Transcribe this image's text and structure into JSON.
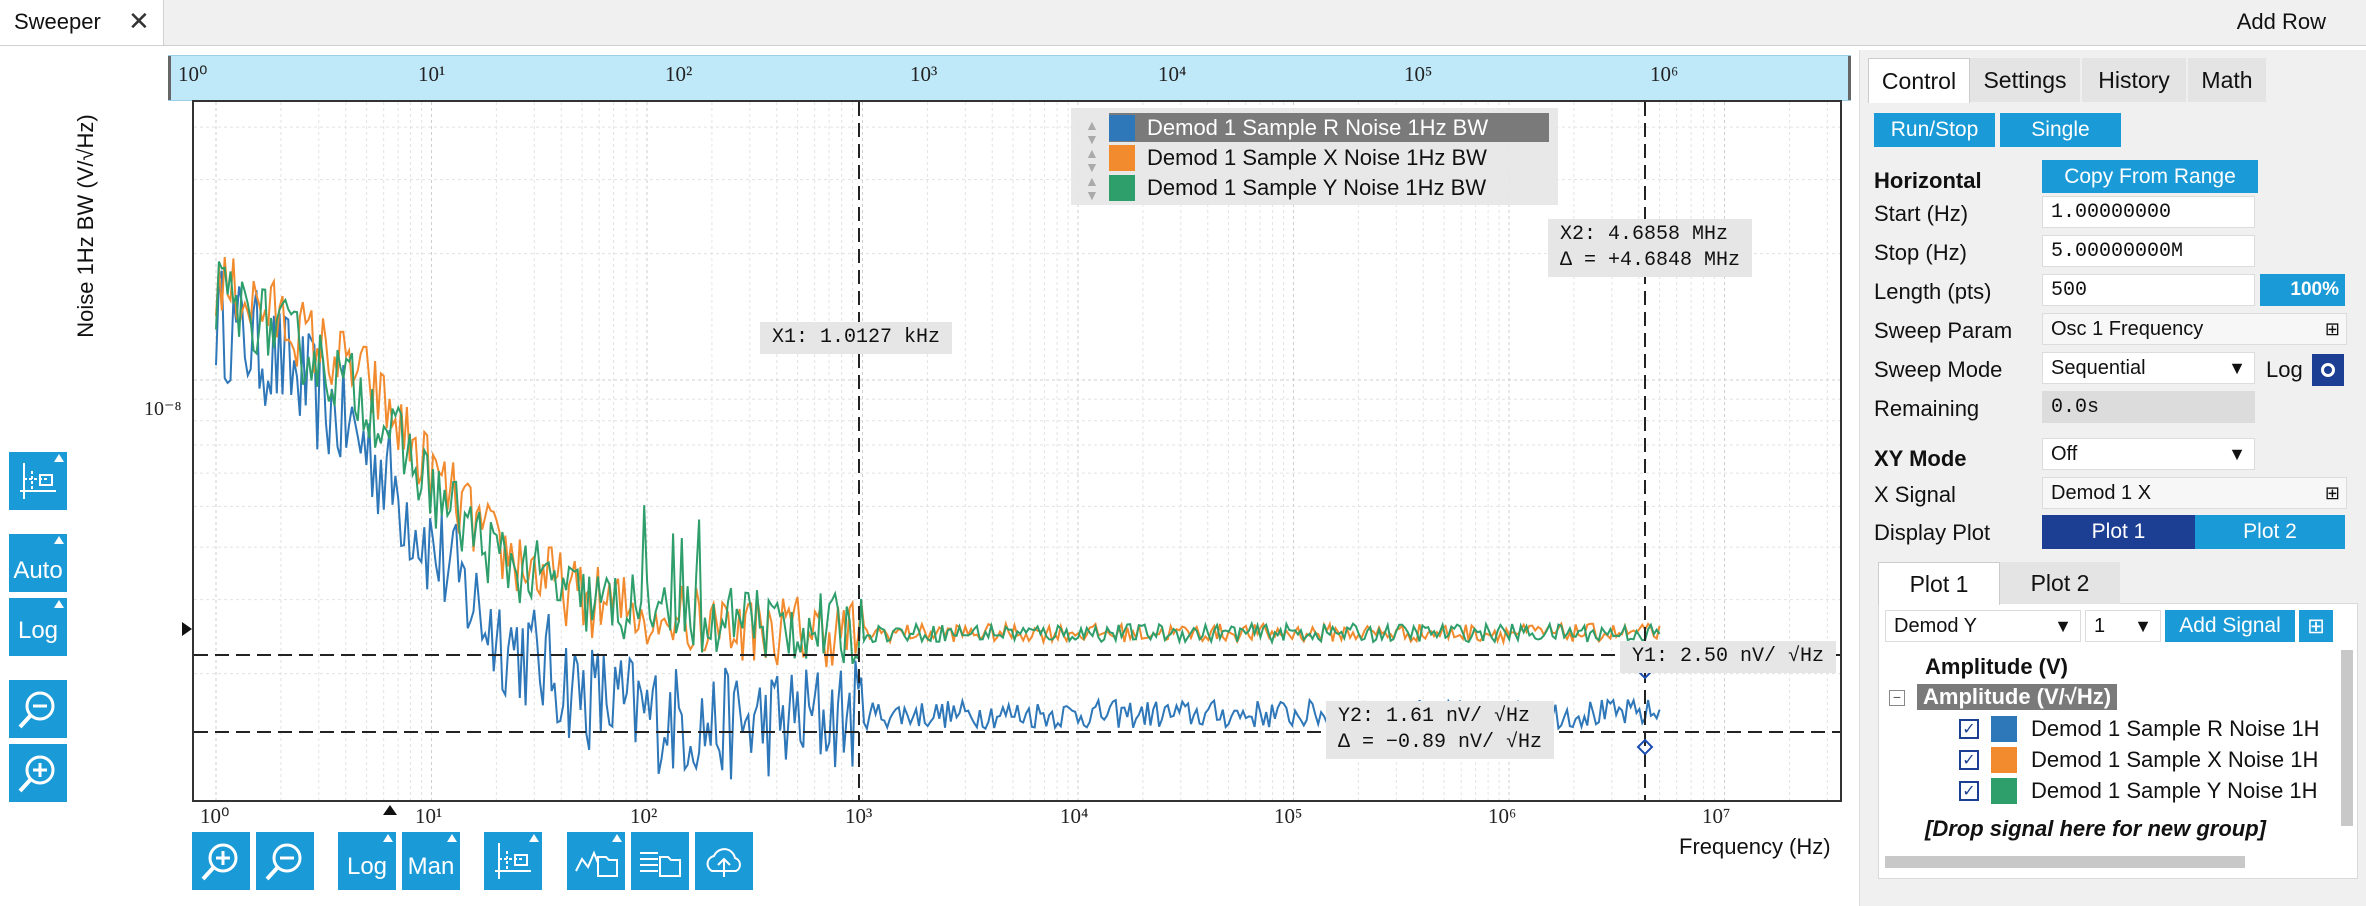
{
  "window": {
    "tab_label": "Sweeper",
    "add_row": "Add Row"
  },
  "plot": {
    "ylabel": "Noise 1Hz BW (V/√Hz)",
    "xlabel": "Frequency (Hz)",
    "ytick": "10⁻⁸",
    "top_ticks": [
      "10⁰",
      "10¹",
      "10²",
      "10³",
      "10⁴",
      "10⁵",
      "10⁶"
    ],
    "bottom_ticks": [
      "10⁰",
      "10¹",
      "10²",
      "10³",
      "10⁴",
      "10⁵",
      "10⁶",
      "10⁷"
    ],
    "legend": [
      {
        "label": "Demod 1 Sample R Noise 1Hz BW",
        "color": "#2e77b8"
      },
      {
        "label": "Demod 1 Sample X Noise 1Hz BW",
        "color": "#f28a2e"
      },
      {
        "label": "Demod 1 Sample Y Noise 1Hz BW",
        "color": "#2e9e6b"
      }
    ],
    "cursors": {
      "x1": "X1: 1.0127 kHz",
      "x2": "X2: 4.6858 MHz",
      "x2_delta": "Δ = +4.6848 MHz",
      "y1": "Y1: 2.50 nV/ √Hz",
      "y2": "Y2: 1.61 nV/ √Hz",
      "y2_delta": "Δ = −0.89 nV/ √Hz"
    }
  },
  "chart_data": {
    "type": "line",
    "xscale": "log",
    "xlim": [
      1,
      5000000
    ],
    "xlabel": "Frequency (Hz)",
    "ylabel": "Noise 1Hz BW (V/√Hz)",
    "grid": true,
    "legend_position": "top",
    "series": [
      {
        "name": "Demod 1 Sample R Noise 1Hz BW",
        "color": "#2e77b8",
        "x": [
          1,
          2,
          5,
          10,
          20,
          50,
          100,
          200,
          1000,
          10000,
          100000,
          1000000,
          5000000
        ],
        "y": [
          1.4e-08,
          1.1e-08,
          7e-09,
          4e-09,
          2.5e-09,
          1.8e-09,
          1.6e-09,
          1.5e-09,
          1.6e-09,
          1.6e-09,
          1.6e-09,
          1.6e-09,
          1.61e-09
        ]
      },
      {
        "name": "Demod 1 Sample X Noise 1Hz BW",
        "color": "#f28a2e",
        "x": [
          1,
          2,
          5,
          10,
          20,
          50,
          100,
          200,
          1000,
          10000,
          100000,
          1000000,
          5000000
        ],
        "y": [
          1.7e-08,
          1.4e-08,
          1e-08,
          6e-09,
          4e-09,
          3e-09,
          2.8e-09,
          2.6e-09,
          2.5e-09,
          2.5e-09,
          2.5e-09,
          2.5e-09,
          2.5e-09
        ]
      },
      {
        "name": "Demod 1 Sample Y Noise 1Hz BW",
        "color": "#2e9e6b",
        "x": [
          1,
          2,
          5,
          10,
          20,
          50,
          100,
          200,
          1000,
          10000,
          100000,
          1000000,
          5000000
        ],
        "y": [
          1.6e-08,
          1.3e-08,
          9e-09,
          5.5e-09,
          3.8e-09,
          3e-09,
          2.8e-09,
          2.7e-09,
          2.5e-09,
          2.5e-09,
          2.5e-09,
          2.5e-09,
          2.5e-09
        ]
      }
    ]
  },
  "left_toolbar": {
    "auto": "Auto",
    "log": "Log"
  },
  "bottom_toolbar": {
    "log": "Log",
    "man": "Man"
  },
  "panel": {
    "tabs": [
      "Control",
      "Settings",
      "History",
      "Math"
    ],
    "run_stop": "Run/Stop",
    "single": "Single",
    "horizontal": "Horizontal",
    "copy_from_range": "Copy From Range",
    "start_label": "Start (Hz)",
    "start_value": "1.00000000",
    "stop_label": "Stop (Hz)",
    "stop_value": "5.00000000M",
    "length_label": "Length (pts)",
    "length_value": "500",
    "progress": "100%",
    "sweep_param_label": "Sweep Param",
    "sweep_param_value": "Osc 1 Frequency",
    "sweep_mode_label": "Sweep Mode",
    "sweep_mode_value": "Sequential",
    "log_label": "Log",
    "remaining_label": "Remaining",
    "remaining_value": "0.0s",
    "xy_mode_label": "XY Mode",
    "xy_mode_value": "Off",
    "x_signal_label": "X Signal",
    "x_signal_value": "Demod 1 X",
    "display_plot_label": "Display Plot",
    "plot1": "Plot 1",
    "plot2": "Plot 2",
    "inner_tabs": [
      "Plot 1",
      "Plot 2"
    ],
    "signal_select": "Demod Y",
    "channel_select": "1",
    "add_signal": "Add Signal",
    "group_amplitude": "Amplitude (V)",
    "group_noise": "Amplitude (V/√Hz)",
    "signals": [
      "Demod 1 Sample R Noise 1H",
      "Demod 1 Sample X Noise 1H",
      "Demod 1 Sample Y Noise 1H"
    ],
    "drop_hint": "[Drop signal here for new group]"
  }
}
